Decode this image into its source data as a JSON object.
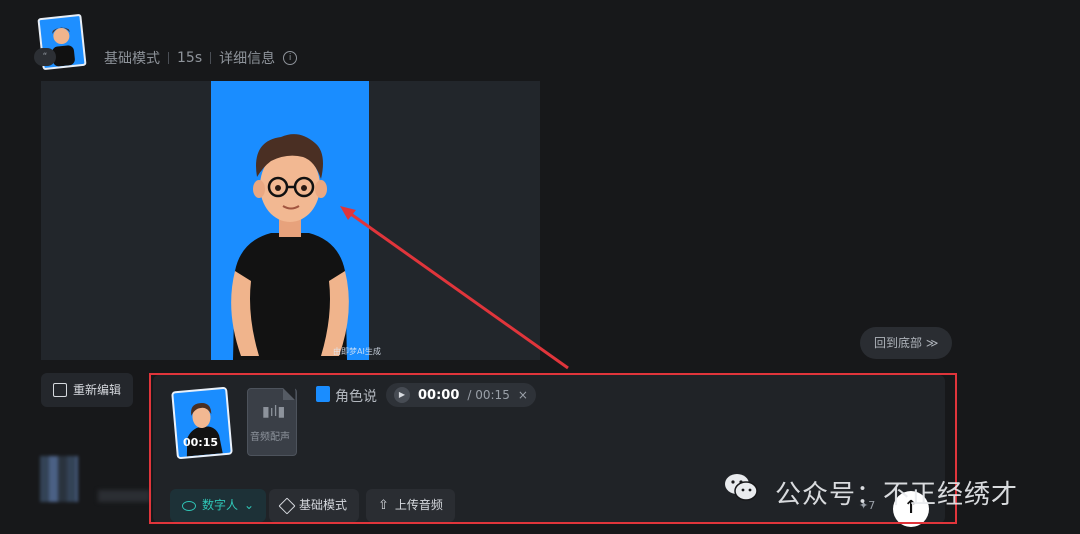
{
  "meta": {
    "mode": "基础模式",
    "duration": "15s",
    "details": "详细信息",
    "badge": "“"
  },
  "video": {
    "watermark": "由即梦AI生成"
  },
  "actions": {
    "reedit": "重新编辑",
    "back_to_bottom": "回到底部 ≫"
  },
  "composer": {
    "thumb_time": "00:15",
    "audio_label": "音频配声",
    "role_label": "角色说",
    "time_current": "00:00",
    "time_total": "/ 00:15",
    "close": "×",
    "toolbar": {
      "digital_human": "数字人",
      "basic_mode": "基础模式",
      "upload_audio": "上传音频"
    },
    "spark_count": "7"
  },
  "watermark": {
    "text": "公众号：不正经绣才"
  },
  "colors": {
    "accent_teal": "#2fc6b7",
    "highlight_red": "#e0353b",
    "preview_blue": "#1a8dff"
  }
}
